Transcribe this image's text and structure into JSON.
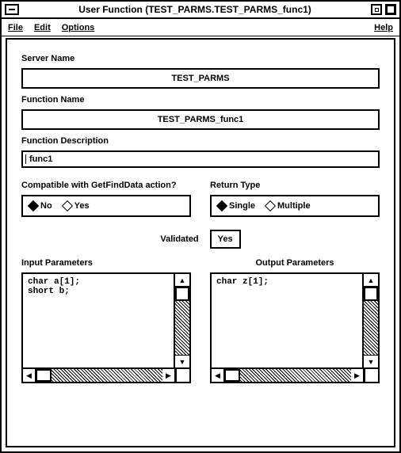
{
  "window": {
    "title": "User Function (TEST_PARMS.TEST_PARMS_func1)"
  },
  "menubar": {
    "file": "File",
    "edit": "Edit",
    "options": "Options",
    "help": "Help"
  },
  "labels": {
    "server_name": "Server Name",
    "function_name": "Function Name",
    "function_description": "Function Description",
    "compatible": "Compatible with GetFindData action?",
    "return_type": "Return Type",
    "validated": "Validated",
    "input_params": "Input Parameters",
    "output_params": "Output Parameters"
  },
  "fields": {
    "server_name": "TEST_PARMS",
    "function_name": "TEST_PARMS_func1",
    "function_description": "func1",
    "validated": "Yes"
  },
  "radios": {
    "compatible": {
      "no": "No",
      "yes": "Yes",
      "selected": "No"
    },
    "return_type": {
      "single": "Single",
      "multiple": "Multiple",
      "selected": "Single"
    }
  },
  "params": {
    "input": "char a[1];\nshort b;",
    "output": "char z[1];"
  }
}
